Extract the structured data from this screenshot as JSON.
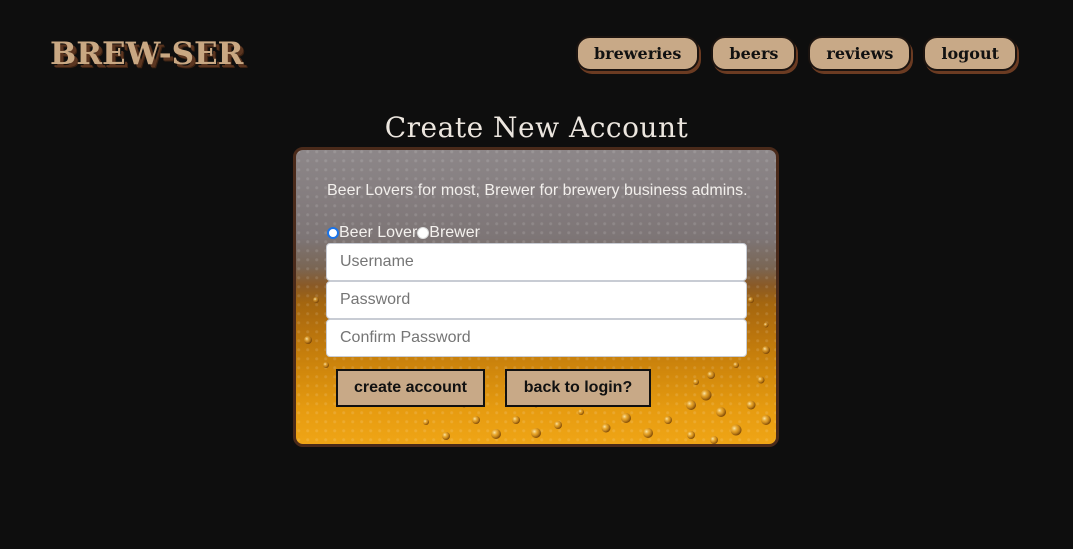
{
  "header": {
    "logo_text": "BREW-SER",
    "nav": [
      {
        "label": "breweries"
      },
      {
        "label": "beers"
      },
      {
        "label": "reviews"
      },
      {
        "label": "logout"
      }
    ]
  },
  "page": {
    "title": "Create New Account"
  },
  "form": {
    "description": "Beer Lovers for most, Brewer for brewery business admins.",
    "account_types": [
      {
        "label": "Beer Lover",
        "selected": true
      },
      {
        "label": "Brewer",
        "selected": false
      }
    ],
    "username": {
      "value": "",
      "placeholder": "Username"
    },
    "password": {
      "value": "",
      "placeholder": "Password"
    },
    "confirm_password": {
      "value": "",
      "placeholder": "Confirm Password"
    },
    "create_button_label": "create account",
    "back_button_label": "back to login?"
  },
  "colors": {
    "background": "#0e0e0e",
    "button_tan": "#c8a987",
    "logo": "#c9a883",
    "radio_checked": "#1a73e8"
  }
}
